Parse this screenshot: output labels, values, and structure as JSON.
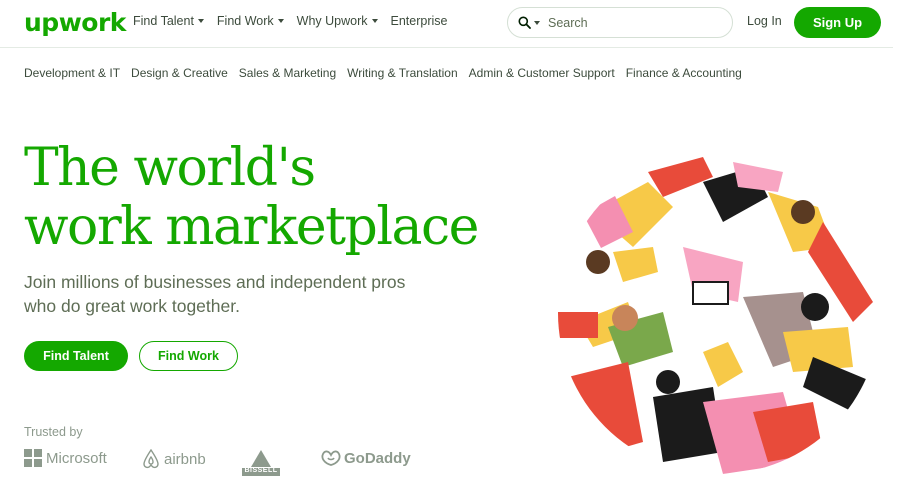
{
  "header": {
    "logo": "upwork",
    "nav": [
      {
        "label": "Find Talent",
        "has_menu": true
      },
      {
        "label": "Find Work",
        "has_menu": true
      },
      {
        "label": "Why Upwork",
        "has_menu": true
      },
      {
        "label": "Enterprise",
        "has_menu": false
      }
    ],
    "search": {
      "placeholder": "Search",
      "icon": "search-icon"
    },
    "login_label": "Log In",
    "signup_label": "Sign Up"
  },
  "categories": [
    "Development & IT",
    "Design & Creative",
    "Sales & Marketing",
    "Writing & Translation",
    "Admin & Customer Support",
    "Finance & Accounting"
  ],
  "hero": {
    "title_line1": "The world's",
    "title_line2": "work marketplace",
    "subtitle_line1": "Join millions of businesses and independent pros",
    "subtitle_line2": "who do great work together.",
    "primary_cta": "Find Talent",
    "secondary_cta": "Find Work"
  },
  "trusted": {
    "label": "Trusted by",
    "brands": [
      "Microsoft",
      "airbnb",
      "BISSELL",
      "GoDaddy"
    ]
  },
  "colors": {
    "brand_green": "#14a800",
    "text_dark": "#001e00",
    "text_muted": "#5e6d55",
    "logo_gray": "#8d9a8d"
  }
}
